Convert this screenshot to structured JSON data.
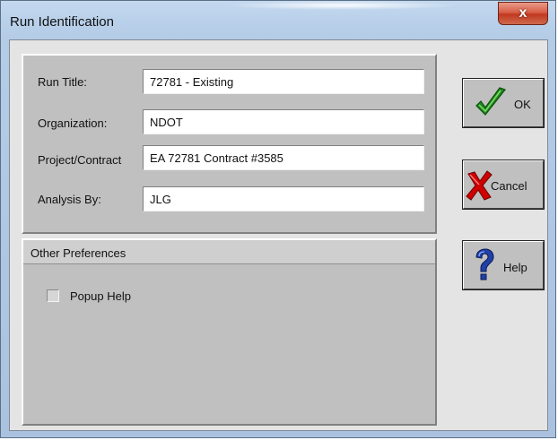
{
  "window": {
    "title": "Run Identification",
    "close_symbol": "x"
  },
  "form": {
    "run_title": {
      "label": "Run Title:",
      "value": "72781 - Existing"
    },
    "organization": {
      "label": "Organization:",
      "value": "NDOT"
    },
    "project_contract": {
      "label": "Project/Contract",
      "value": "EA 72781 Contract #3585"
    },
    "analysis_by": {
      "label": "Analysis By:",
      "value": "JLG"
    }
  },
  "preferences": {
    "header": "Other Preferences",
    "popup_help": {
      "label": "Popup Help",
      "checked": false
    }
  },
  "buttons": {
    "ok": {
      "label": "OK",
      "icon": "checkmark-icon"
    },
    "cancel": {
      "label": "Cancel",
      "icon": "x-mark-icon"
    },
    "help": {
      "label": "Help",
      "icon": "question-mark-icon"
    }
  },
  "colors": {
    "ok_check": "#1e8a1e",
    "cancel_x": "#d00000",
    "help_q": "#2040a8"
  }
}
